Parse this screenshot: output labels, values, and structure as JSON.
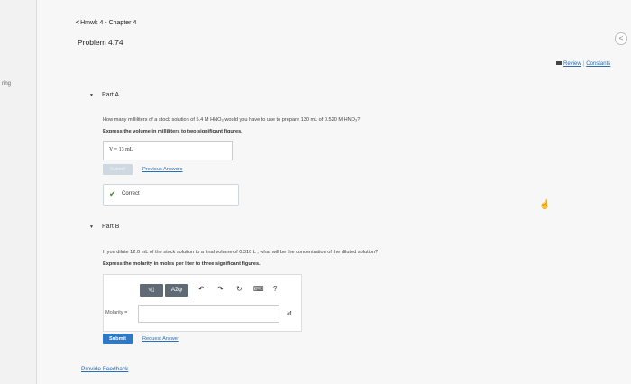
{
  "sidebar": {
    "cut_text": "ring"
  },
  "header": {
    "breadcrumb": "Hmwk 4 - Chapter 4",
    "problem_title": "Problem 4.74",
    "review_link": "Review",
    "constants_link": "Constants",
    "links_separator": "|"
  },
  "part_a": {
    "label": "Part A",
    "question": "How many milliliters of a stock solution of 5.4 M HNO₃ would you have to use to prepare 130 mL of 0.520 M HNO₃?",
    "instruction": "Express the volume in milliliters to two significant figures.",
    "answer_text": "V =  13  mL",
    "submit_label": "Submit",
    "previous_answers_link": "Previous Answers",
    "status": "Correct"
  },
  "part_b": {
    "label": "Part B",
    "question": "If you dilute 12.0 mL of the stock solution to a final volume of 0.310 L , what will be the concentration of the diluted solution?",
    "instruction": "Express the molarity in moles per liter to three significant figures.",
    "toolbar": {
      "templates_label": "√▯",
      "greek_label": "ΑΣφ",
      "undo_icon": "↶",
      "redo_icon": "↷",
      "reset_icon": "↻",
      "keyboard_icon": "⌨",
      "help_icon": "?"
    },
    "input_label": "Molarity =",
    "input_value": "",
    "unit": "M",
    "submit_label": "Submit",
    "request_answer_link": "Request Answer"
  },
  "footer": {
    "feedback_link": "Provide Feedback"
  }
}
